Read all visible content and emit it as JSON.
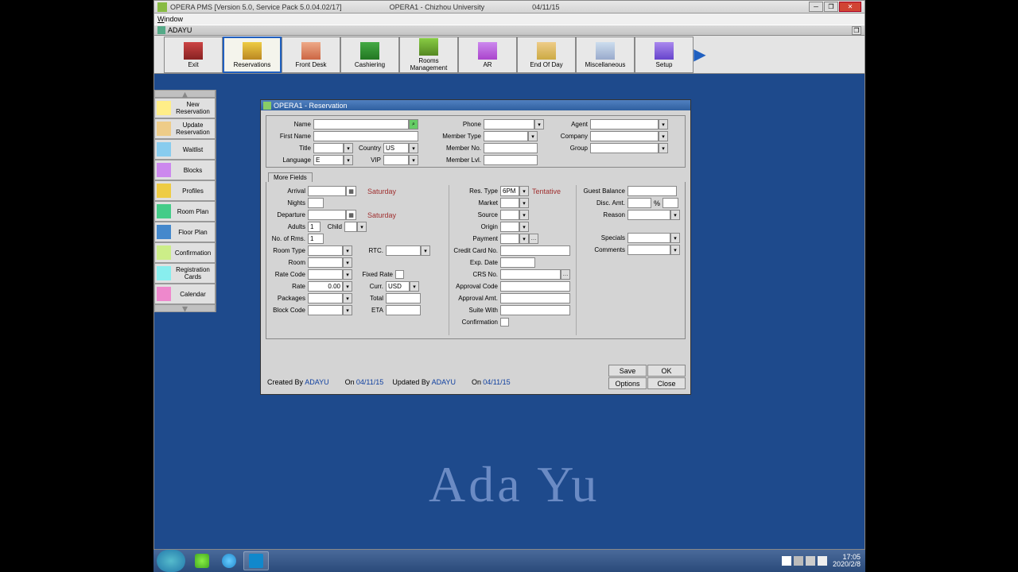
{
  "titlebar": {
    "app": "OPERA PMS [Version 5.0, Service Pack 5.0.04.02/17]",
    "instance": "OPERA1 - Chizhou University",
    "date": "04/11/15"
  },
  "menubar": "Window",
  "subtitle": "ADAYU",
  "toolbar": [
    {
      "label": "Exit",
      "name": "exit"
    },
    {
      "label": "Reservations",
      "name": "reservations"
    },
    {
      "label": "Front Desk",
      "name": "front-desk"
    },
    {
      "label": "Cashiering",
      "name": "cashiering"
    },
    {
      "label": "Rooms\nManagement",
      "name": "rooms-management"
    },
    {
      "label": "AR",
      "name": "ar"
    },
    {
      "label": "End Of Day",
      "name": "end-of-day"
    },
    {
      "label": "Miscellaneous",
      "name": "miscellaneous"
    },
    {
      "label": "Setup",
      "name": "setup"
    }
  ],
  "sidebar": [
    {
      "label": "New\nReservation"
    },
    {
      "label": "Update\nReservation"
    },
    {
      "label": "Waitlist"
    },
    {
      "label": "Blocks"
    },
    {
      "label": "Profiles"
    },
    {
      "label": "Room Plan"
    },
    {
      "label": "Floor Plan"
    },
    {
      "label": "Confirmation"
    },
    {
      "label": "Registration\nCards"
    },
    {
      "label": "Calendar"
    }
  ],
  "res_window": {
    "title": "OPERA1 - Reservation",
    "labels": {
      "name": "Name",
      "first_name": "First Name",
      "title": "Title",
      "country": "Country",
      "language": "Language",
      "vip": "VIP",
      "phone": "Phone",
      "member_type": "Member Type",
      "member_no": "Member No.",
      "member_lvl": "Member Lvl.",
      "agent": "Agent",
      "company": "Company",
      "group": "Group",
      "more_fields": "More Fields",
      "arrival": "Arrival",
      "nights": "Nights",
      "departure": "Departure",
      "adults": "Adults",
      "child": "Child",
      "no_of_rms": "No. of Rms.",
      "room_type": "Room Type",
      "rtc": "RTC.",
      "room": "Room",
      "rate_code": "Rate Code",
      "fixed_rate": "Fixed Rate",
      "rate": "Rate",
      "curr": "Curr.",
      "packages": "Packages",
      "total": "Total",
      "block_code": "Block Code",
      "eta": "ETA",
      "res_type": "Res. Type",
      "market": "Market",
      "source": "Source",
      "origin": "Origin",
      "payment": "Payment",
      "credit_card_no": "Credit Card No.",
      "exp_date": "Exp. Date",
      "crs_no": "CRS No.",
      "approval_code": "Approval Code",
      "approval_amt": "Approval Amt.",
      "suite_with": "Suite With",
      "confirmation": "Confirmation",
      "guest_balance": "Guest Balance",
      "disc_amt": "Disc. Amt.",
      "pct": "%",
      "reason": "Reason",
      "specials": "Specials",
      "comments": "Comments"
    },
    "values": {
      "country": "US",
      "language": "E",
      "adults": "1",
      "no_of_rms": "1",
      "rate": "0.00",
      "curr": "USD",
      "res_type": "6PM",
      "tentative": "Tentative",
      "arrival_day": "Saturday",
      "departure_day": "Saturday"
    },
    "footer": {
      "created_by_lbl": "Created By",
      "created_by": "ADAYU",
      "on1": "On",
      "on1_val": "04/11/15",
      "updated_by_lbl": "Updated By",
      "updated_by": "ADAYU",
      "on2": "On",
      "on2_val": "04/11/15"
    },
    "buttons": {
      "save": "Save",
      "ok": "OK",
      "options": "Options",
      "close": "Close"
    }
  },
  "watermark": "Ada Yu",
  "taskbar": {
    "time": "17:05",
    "date": "2020/2/8"
  }
}
